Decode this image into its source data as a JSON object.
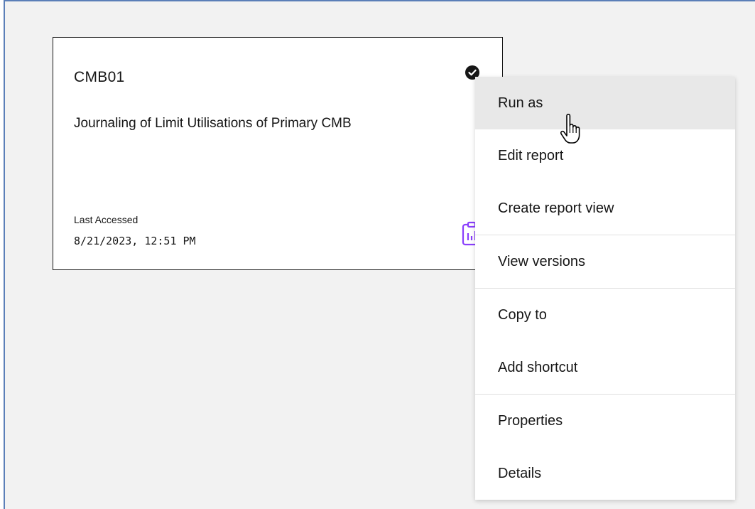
{
  "card": {
    "title": "CMB01",
    "description": "Journaling of Limit Utilisations of Primary CMB",
    "last_accessed_label": "Last Accessed",
    "last_accessed_value": "8/21/2023, 12:51 PM",
    "selected_icon": "checkmark-filled-icon",
    "type_icon": "report-icon",
    "type_icon_color": "#8a3ffc"
  },
  "context_menu": {
    "items": [
      {
        "label": "Run as",
        "hovered": true
      },
      {
        "label": "Edit report"
      },
      {
        "label": "Create report view"
      },
      {
        "label": "View versions"
      },
      {
        "label": "Copy to"
      },
      {
        "label": "Add shortcut"
      },
      {
        "label": "Properties"
      },
      {
        "label": "Details"
      }
    ]
  },
  "cursor": "hand-pointer-icon"
}
